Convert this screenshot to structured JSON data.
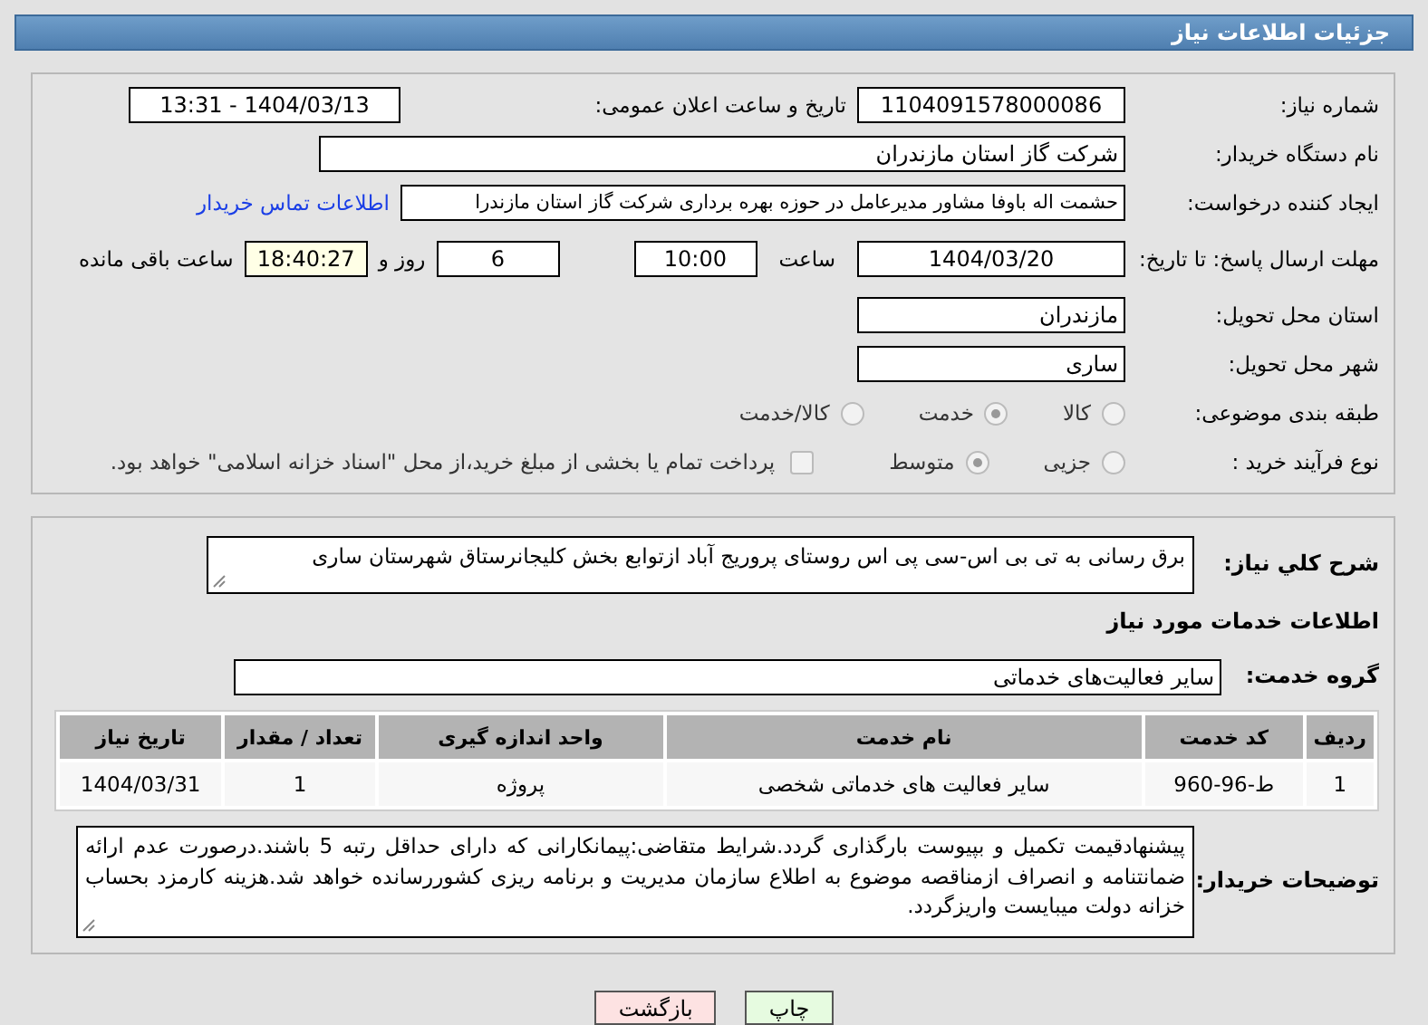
{
  "header": {
    "title": "جزئیات اطلاعات نیاز"
  },
  "details": {
    "need_number": {
      "label": "شماره نیاز:",
      "value": "1104091578000086"
    },
    "announce": {
      "label": "تاریخ و ساعت اعلان عمومی:",
      "value": "1404/03/13 - 13:31"
    },
    "buyer": {
      "label": "نام دستگاه خریدار:",
      "value": "شرکت گاز استان مازندران"
    },
    "requester": {
      "label": "ایجاد کننده درخواست:",
      "value": "حشمت اله باوفا مشاور مدیرعامل در حوزه بهره برداری  شرکت گاز استان مازندرا",
      "link": "اطلاعات تماس خریدار"
    },
    "deadline": {
      "label": "مهلت ارسال پاسخ: تا تاریخ:",
      "date": "1404/03/20",
      "time_label": "ساعت",
      "time": "10:00",
      "days": "6",
      "days_label": "روز و",
      "remaining": "18:40:27",
      "remaining_label": "ساعت باقی مانده"
    },
    "province": {
      "label": "استان محل تحویل:",
      "value": "مازندران"
    },
    "city": {
      "label": "شهر محل تحویل:",
      "value": "ساری"
    },
    "category": {
      "label": "طبقه بندی موضوعی:",
      "options": [
        {
          "label": "کالا",
          "selected": false
        },
        {
          "label": "خدمت",
          "selected": true
        },
        {
          "label": "کالا/خدمت",
          "selected": false
        }
      ]
    },
    "process": {
      "label": "نوع فرآیند خرید :",
      "options": [
        {
          "label": "جزیی",
          "selected": false
        },
        {
          "label": "متوسط",
          "selected": true
        }
      ],
      "payment": {
        "checked": false,
        "label": "پرداخت تمام یا بخشی از مبلغ خرید،از محل \"اسناد خزانه اسلامی\" خواهد بود."
      }
    }
  },
  "services": {
    "description": {
      "label": "شرح کلي نياز:",
      "value": "برق رسانی به تی بی اس-سی پی اس روستای پروریج  آباد ازتوابع بخش کلیجانرستاق شهرستان ساری"
    },
    "heading": "اطلاعات خدمات مورد نياز",
    "group": {
      "label": "گروه خدمت:",
      "value": "سایر فعالیت‌های خدماتی"
    },
    "table": {
      "columns": [
        "ردیف",
        "کد خدمت",
        "نام خدمت",
        "واحد اندازه گیری",
        "تعداد / مقدار",
        "تاریخ نیاز"
      ],
      "rows": [
        [
          "1",
          "ط-96-960",
          "سایر فعالیت های خدماتی شخصی",
          "پروژه",
          "1",
          "1404/03/31"
        ]
      ]
    },
    "notes": {
      "label": "توضیحات خریدار:",
      "value": "پیشنهادقیمت تکمیل و بپیوست بارگذاری گردد.شرایط متقاضی:پیمانکارانی که دارای حداقل رتبه 5 باشند.درصورت عدم ارائه ضمانتنامه و انصراف ازمناقصه موضوع به اطلاع سازمان مدیریت و برنامه ریزی کشوررسانده خواهد شد.هزینه کارمزد بحساب خزانه دولت میبایست واریزگردد."
    }
  },
  "buttons": [
    {
      "label": "چاپ",
      "kind": "print"
    },
    {
      "label": "بازگشت",
      "kind": "back"
    }
  ]
}
